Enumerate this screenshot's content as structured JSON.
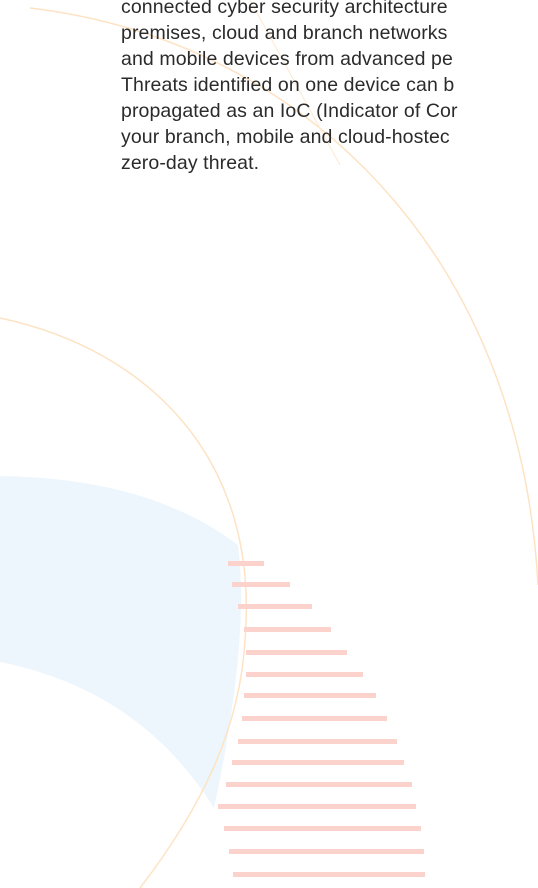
{
  "article": {
    "lines": [
      "connected cyber security architecture",
      "premises, cloud and branch networks",
      "and mobile devices from advanced pe",
      "Threats identified on one device can b",
      "propagated as an IoC (Indicator of Cor",
      "your branch, mobile and cloud-hostec",
      "zero-day threat."
    ]
  },
  "colors": {
    "text": "#2b2b2b",
    "arc_orange": "#fde0b8",
    "blue_shape": "#eef6fd",
    "stripes": "#fcd3cc"
  }
}
